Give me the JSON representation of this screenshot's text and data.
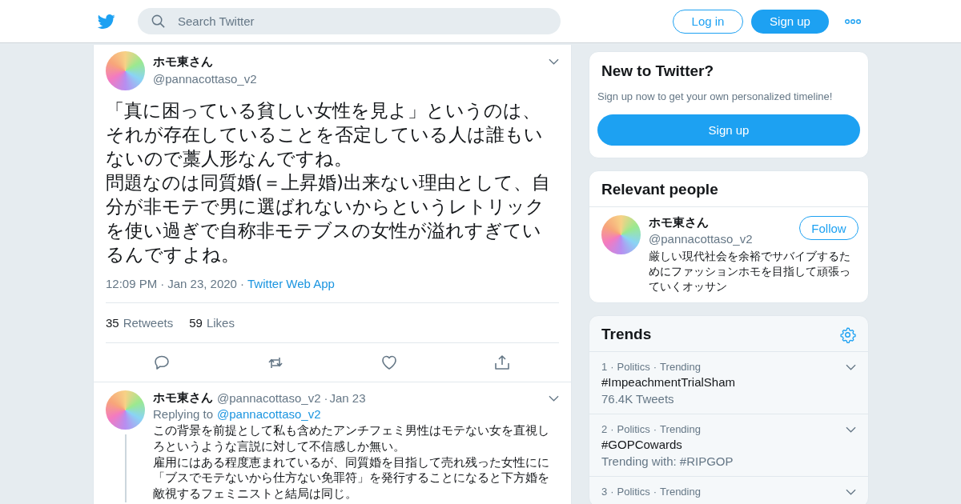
{
  "header": {
    "search": {
      "placeholder": "Search Twitter"
    },
    "login": "Log in",
    "signup": "Sign up"
  },
  "tweet": {
    "name": "ホモ東さん",
    "handle": "@pannacottaso_v2",
    "text": [
      "「真に困っている貧しい女性を見よ」というのは、それが存在していることを否定している人は誰もいないので藁人形なんですね。",
      "問題なのは同質婚(＝上昇婚)出来ない理由として、自分が非モテで男に選ばれないからというレトリックを使い過ぎで自称非モテブスの女性が溢れすぎているんですよね。"
    ],
    "separator": "·",
    "time": "12:09 PM",
    "date": "Jan 23, 2020",
    "source": "Twitter Web App",
    "stats": [
      {
        "count": "35",
        "label": "Retweets"
      },
      {
        "count": "59",
        "label": "Likes"
      }
    ],
    "actions": [
      {
        "kind": "reply"
      },
      {
        "kind": "retweet"
      },
      {
        "kind": "like"
      },
      {
        "kind": "share"
      }
    ]
  },
  "reply": {
    "name": "ホモ東さん",
    "handle": "@pannacottaso_v2",
    "date": "Jan 23",
    "replying_label": "Replying to",
    "replying_to": "@pannacottaso_v2",
    "separator": "·",
    "text": [
      "この背景を前提として私も含めたアンチフェミ男性はモテない女を直視しろというような言説に対して不信感しか無い。",
      "雇用にはある程度恵まれているが、同質婚を目指して売れ残った女性にに「ブスでモテないから仕方ない免罪符」を発行することになると下方婚を敵視するフェミニストと結局は同じ。"
    ]
  },
  "signup_card": {
    "title": "New to Twitter?",
    "subtitle": "Sign up now to get your own personalized timeline!",
    "button": "Sign up"
  },
  "relevant_people": {
    "title": "Relevant people",
    "people": [
      {
        "name": "ホモ東さん",
        "handle": "@pannacottaso_v2",
        "bio": "厳しい現代社会を余裕でサバイブするためにファッションホモを目指して頑張っていくオッサン",
        "button": "Follow"
      }
    ]
  },
  "trends": {
    "title": "Trends",
    "separator": "·",
    "items": [
      {
        "rank": "1",
        "category": "Politics",
        "status": "Trending",
        "name": "#ImpeachmentTrialSham",
        "detail": "76.4K Tweets"
      },
      {
        "rank": "2",
        "category": "Politics",
        "status": "Trending",
        "name": "#GOPCowards",
        "detail": "Trending with: #RIPGOP"
      },
      {
        "rank": "3",
        "category": "Politics",
        "status": "Trending"
      }
    ]
  }
}
